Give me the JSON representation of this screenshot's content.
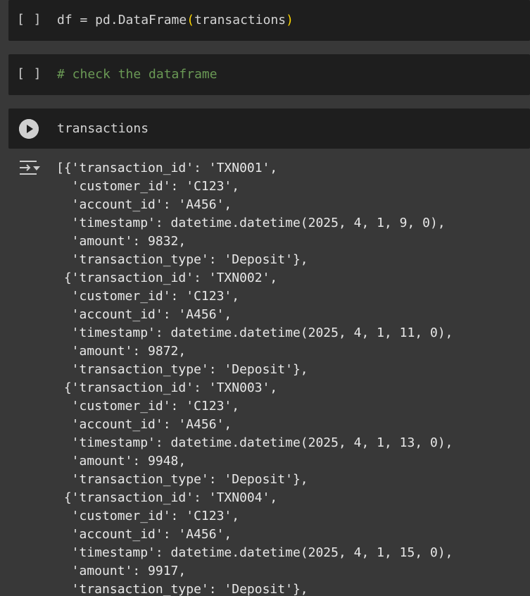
{
  "cells": [
    {
      "exec_count": "[ ]",
      "code_parts": {
        "prefix": "df = pd.DataFrame",
        "open_paren": "(",
        "arg": "transactions",
        "close_paren": ")"
      }
    },
    {
      "exec_count": "[ ]",
      "comment": "# check the dataframe"
    },
    {
      "code": "transactions"
    }
  ],
  "output": {
    "lines": [
      "[{'transaction_id': 'TXN001',",
      "  'customer_id': 'C123',",
      "  'account_id': 'A456',",
      "  'timestamp': datetime.datetime(2025, 4, 1, 9, 0),",
      "  'amount': 9832,",
      "  'transaction_type': 'Deposit'},",
      " {'transaction_id': 'TXN002',",
      "  'customer_id': 'C123',",
      "  'account_id': 'A456',",
      "  'timestamp': datetime.datetime(2025, 4, 1, 11, 0),",
      "  'amount': 9872,",
      "  'transaction_type': 'Deposit'},",
      " {'transaction_id': 'TXN003',",
      "  'customer_id': 'C123',",
      "  'account_id': 'A456',",
      "  'timestamp': datetime.datetime(2025, 4, 1, 13, 0),",
      "  'amount': 9948,",
      "  'transaction_type': 'Deposit'},",
      " {'transaction_id': 'TXN004',",
      "  'customer_id': 'C123',",
      "  'account_id': 'A456',",
      "  'timestamp': datetime.datetime(2025, 4, 1, 15, 0),",
      "  'amount': 9917,",
      "  'transaction_type': 'Deposit'},"
    ]
  },
  "icons": {
    "run": "play-circle-icon",
    "output_toggle": "output-collapse-icon"
  },
  "colors": {
    "background": "#383838",
    "cell_background": "#1e1e1e",
    "comment": "#6a9955",
    "paren": "#ffd700"
  }
}
